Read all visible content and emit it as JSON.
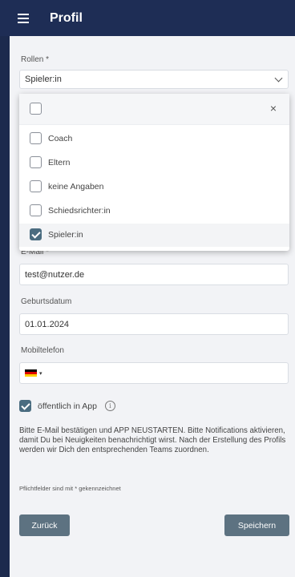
{
  "header": {
    "title": "Profil"
  },
  "form": {
    "roles": {
      "label": "Rollen *",
      "value": "Spieler:in",
      "dropdown": {
        "options": [
          {
            "label": "Coach",
            "checked": false
          },
          {
            "label": "Eltern",
            "checked": false
          },
          {
            "label": "keine Angaben",
            "checked": false
          },
          {
            "label": "Schiedsrichter:in",
            "checked": false
          },
          {
            "label": "Spieler:in",
            "checked": true
          }
        ],
        "close_symbol": "×"
      }
    },
    "email": {
      "label": "E-Mail *",
      "value": "test@nutzer.de"
    },
    "birthdate": {
      "label": "Geburtsdatum",
      "value": "01.01.2024"
    },
    "mobile": {
      "label": "Mobiltelefon",
      "country_suffix": "▾"
    },
    "public": {
      "label": "öffentlich in App",
      "checked": true,
      "info_symbol": "i"
    },
    "notice": "Bitte E-Mail bestätigen und APP NEUSTARTEN. Bitte Notifications aktivieren, damit Du bei Neuigkeiten benachrichtigt wirst. Nach der Erstellung des Profils werden wir Dich den entsprechenden Teams zuordnen.",
    "required_note": "Pflichtfelder sind mit * gekennzeichnet"
  },
  "buttons": {
    "back": "Zurück",
    "save": "Speichern"
  },
  "colors": {
    "appbar": "#1e2d55",
    "button": "#5d7281",
    "checked": "#4a6c80"
  }
}
